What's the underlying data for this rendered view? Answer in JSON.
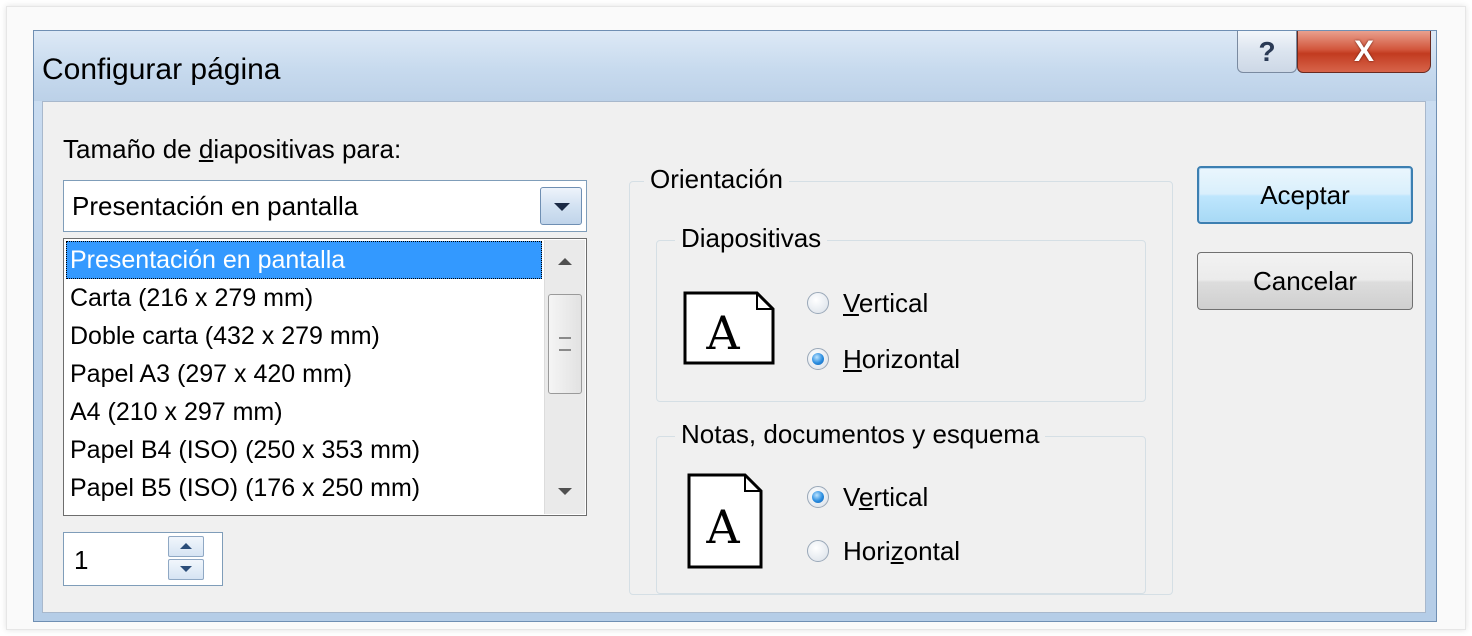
{
  "dialog": {
    "title": "Configurar página",
    "help_glyph": "?",
    "close_glyph": "X"
  },
  "slide_size": {
    "label_pre": "Tamaño de ",
    "label_mnemonic": "d",
    "label_post": "iapositivas para:",
    "selected": "Presentación en pantalla",
    "options": [
      "Presentación en pantalla",
      "Carta (216 x 279 mm)",
      "Doble carta (432 x 279 mm)",
      "Papel A3 (297 x 420 mm)",
      "A4 (210 x 297 mm)",
      "Papel B4 (ISO) (250 x 353 mm)",
      "Papel B5 (ISO) (176 x 250 mm)"
    ]
  },
  "numbering": {
    "value": "1"
  },
  "orientation": {
    "title": "Orientación",
    "slides": {
      "title": "Diapositivas",
      "icon_letter": "A",
      "vertical": {
        "mnemonic": "V",
        "rest": "ertical",
        "checked": false
      },
      "horizontal": {
        "mnemonic": "H",
        "rest": "orizontal",
        "checked": true
      }
    },
    "notes": {
      "title": "Notas, documentos y esquema",
      "icon_letter": "A",
      "vertical": {
        "pre": "V",
        "mnemonic": "e",
        "rest": "rtical",
        "checked": true
      },
      "horizontal": {
        "pre": "Hori",
        "mnemonic": "z",
        "rest": "ontal",
        "checked": false
      }
    }
  },
  "buttons": {
    "accept": "Aceptar",
    "cancel": "Cancelar"
  },
  "colors": {
    "selection": "#3399ff",
    "default_button_border": "#3c7fb1",
    "close_button": "#c23b20",
    "title_bar": "#c7daee"
  }
}
